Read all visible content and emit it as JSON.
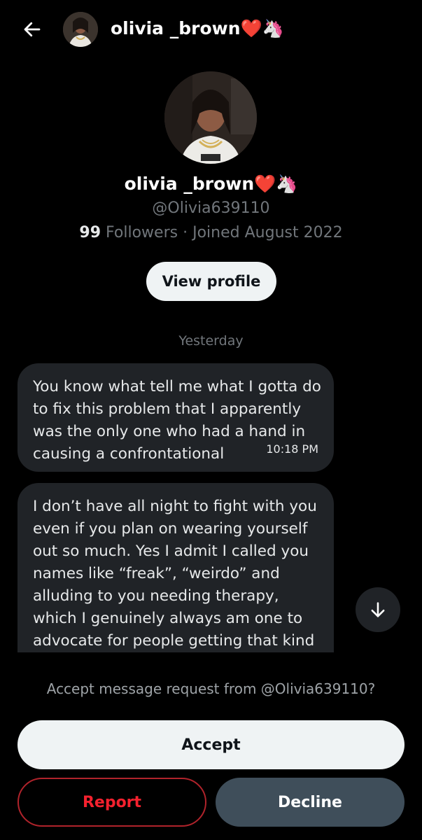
{
  "header": {
    "back_icon": "arrow-left-icon",
    "display_name": "olivia _brown❤️🦄"
  },
  "profile": {
    "display_name": "olivia _brown❤️🦄",
    "handle": "@Olivia639110",
    "followers_count": "99",
    "followers_label": "Followers",
    "separator": "·",
    "joined": "Joined August 2022",
    "view_profile_label": "View profile"
  },
  "conversation": {
    "date_separator": "Yesterday",
    "messages": [
      {
        "lines": [
          "You know what tell me what I gotta do",
          "to fix this problem that I apparently",
          "was the only one who had a hand in",
          "causing a confrontational"
        ],
        "time": "10:18 PM"
      },
      {
        "lines": [
          "I don’t have all night to fight with you",
          "even if you plan on wearing yourself",
          "out so much. Yes I admit I called you",
          "names like “freak”, “weirdo” and",
          "alluding to you needing therapy,",
          "which I genuinely always am one to",
          "advocate for people getting that kind"
        ]
      }
    ],
    "scroll_down_icon": "arrow-down-icon"
  },
  "request": {
    "prompt": "Accept message request from @Olivia639110?",
    "accept_label": "Accept",
    "report_label": "Report",
    "decline_label": "Decline"
  },
  "colors": {
    "background": "#000000",
    "bubble": "#202327",
    "report_red": "#f4212e",
    "decline_bg": "#3f4e5a"
  }
}
